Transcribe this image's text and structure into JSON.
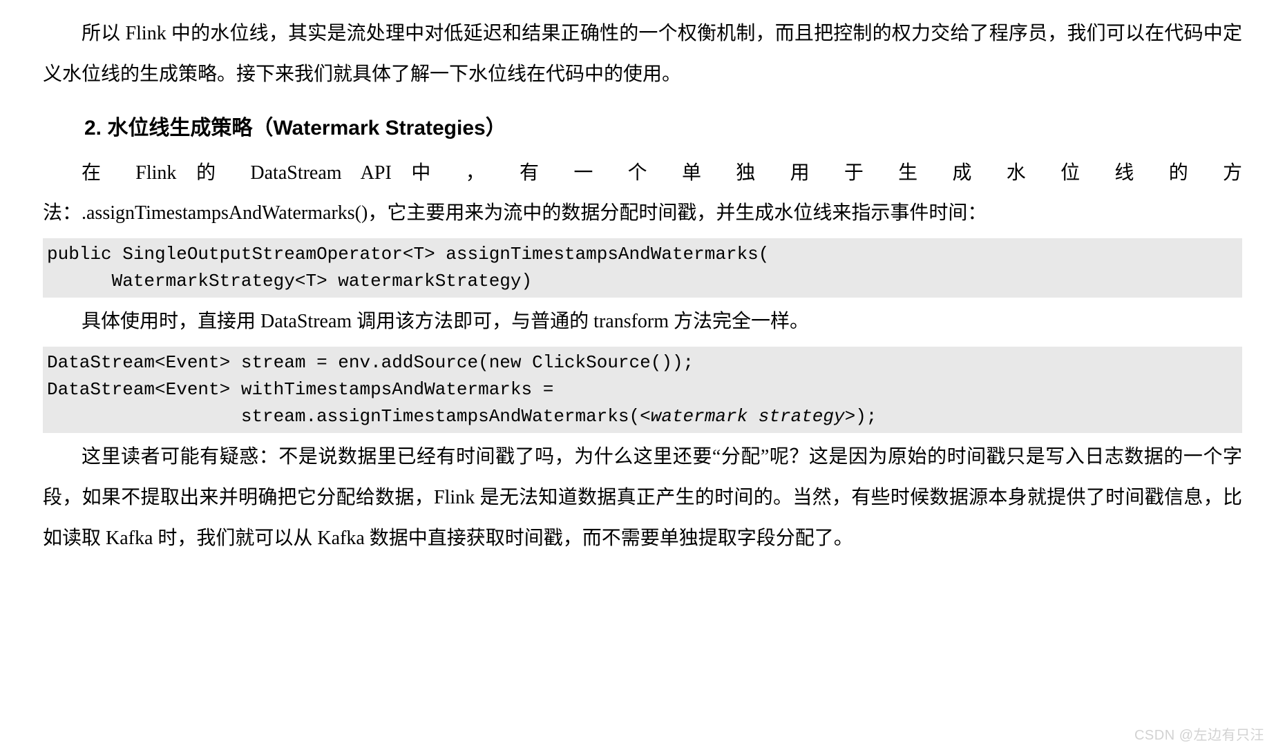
{
  "para1": "所以 Flink 中的水位线，其实是流处理中对低延迟和结果正确性的一个权衡机制，而且把控制的权力交给了程序员，我们可以在代码中定义水位线的生成策略。接下来我们就具体了解一下水位线在代码中的使用。",
  "heading": "2. 水位线生成策略（Watermark Strategies）",
  "para2_line1_prefix": "在  Flink  的  DataStream  API  中 ， 有 一 个 单 独 用 于 生 成 水 位 线 的 方",
  "para2_rest": "法：.assignTimestampsAndWatermarks()，它主要用来为流中的数据分配时间戳，并生成水位线来指示事件时间：",
  "code1_line1": "public SingleOutputStreamOperator<T> assignTimestampsAndWatermarks(",
  "code1_line2": "      WatermarkStrategy<T> watermarkStrategy)",
  "para3": "具体使用时，直接用 DataStream 调用该方法即可，与普通的 transform 方法完全一样。",
  "code2_line1": "DataStream<Event> stream = env.addSource(new ClickSource());",
  "code2_line2": "DataStream<Event> withTimestampsAndWatermarks = ",
  "code2_line3_pre": "                  stream.assignTimestampsAndWatermarks(",
  "code2_line3_italic": "<watermark strategy>",
  "code2_line3_post": ");",
  "para4": "这里读者可能有疑惑：不是说数据里已经有时间戳了吗，为什么这里还要“分配”呢？这是因为原始的时间戳只是写入日志数据的一个字段，如果不提取出来并明确把它分配给数据，Flink 是无法知道数据真正产生的时间的。当然，有些时候数据源本身就提供了时间戳信息，比如读取 Kafka 时，我们就可以从 Kafka 数据中直接获取时间戳，而不需要单独提取字段分配了。",
  "watermark": "CSDN @左边有只汪"
}
